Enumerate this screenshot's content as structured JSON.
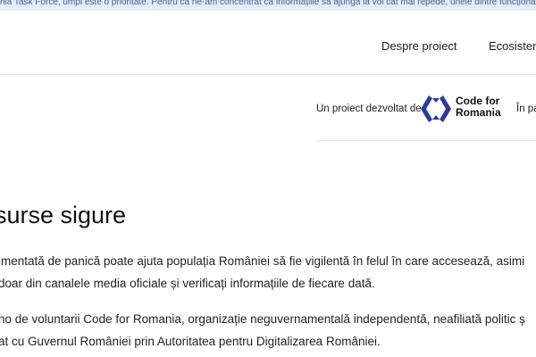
{
  "banner": {
    "text": "nia Task Force, umpi este o prioritate. Pentru că ne-am concentrat ca informațiile să ajungă la voi cât mai repede, unele dintre funcționalități voi"
  },
  "nav": {
    "items": [
      {
        "label": "Despre proiect"
      },
      {
        "label": "Ecosistem"
      }
    ]
  },
  "developer": {
    "label": "Un proiect dezvoltat de",
    "logo_line1": "Code for",
    "logo_line2": "Romania",
    "partner_label": "În pa",
    "logo_icon": "code-for-romania-logo-icon",
    "logo_color": "#2c3a9e"
  },
  "main": {
    "heading": "surse sigure",
    "paragraph1": [
      "imentată de panică poate ajuta populația României să fie vigilentă în felul în care accesează, asimi",
      "doar din canalele media oficiale și verificați informațiile de fiecare dată."
    ],
    "paragraph2": [
      "no de voluntarii Code for Romania, organizație neguvernamentală independentă, neafiliată politic ș",
      "at cu Guvernul României prin Autoritatea pentru Digitalizarea României."
    ]
  }
}
